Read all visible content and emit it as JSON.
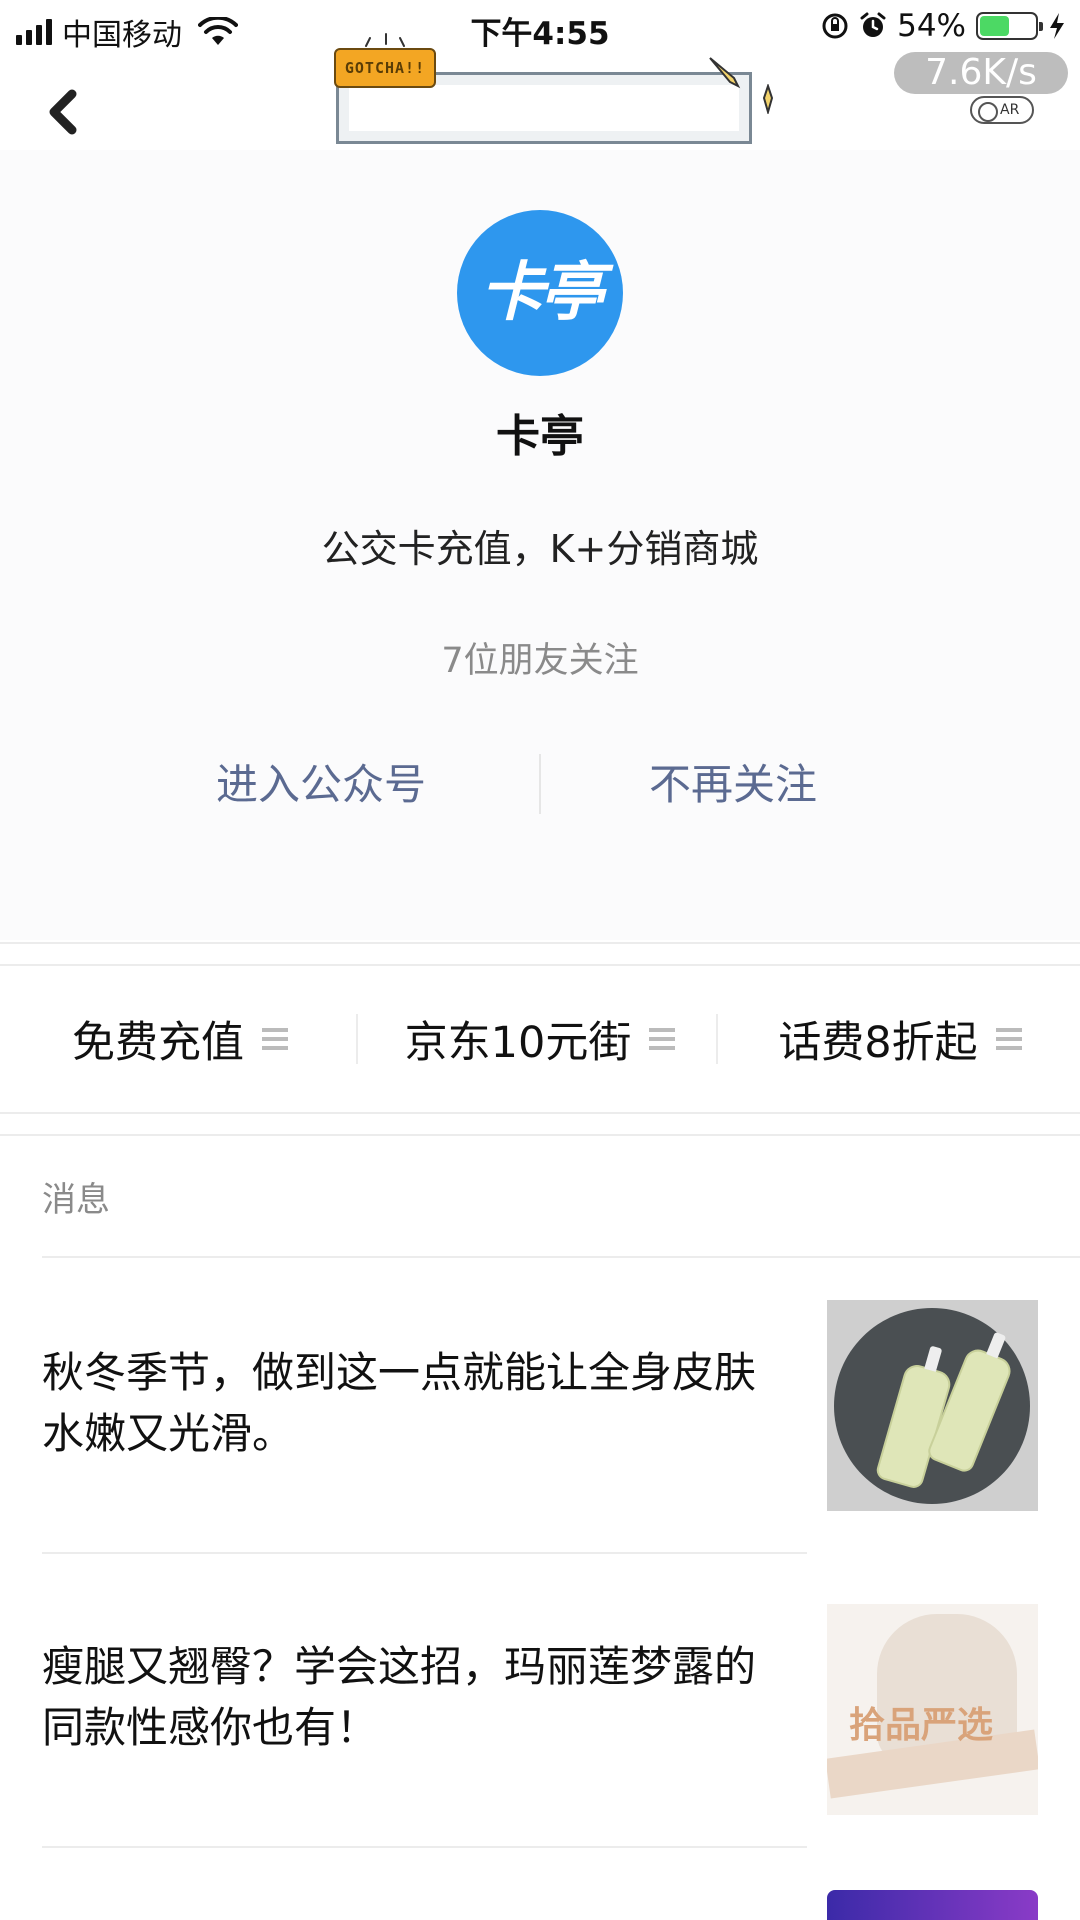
{
  "status_bar": {
    "carrier": "中国移动",
    "time": "下午4:55",
    "battery_percent": "54%",
    "battery_level": 0.54,
    "net_speed": "7.6K/s",
    "ar_label": "AR"
  },
  "nav": {
    "badge": "GOTCHA!!"
  },
  "profile": {
    "avatar_text": "卡亭",
    "avatar_color": "#2e97ee",
    "name": "卡亭",
    "description": "公交卡充值，K+分销商城",
    "friends_following": "7位朋友关注",
    "actions": {
      "enter": "进入公众号",
      "unfollow": "不再关注"
    }
  },
  "menu": {
    "items": [
      {
        "label": "免费充值"
      },
      {
        "label": "京东10元街"
      },
      {
        "label": "话费8折起"
      }
    ]
  },
  "messages": {
    "section_title": "消息",
    "items": [
      {
        "title": "秋冬季节，做到这一点就能让全身皮肤水嫩又光滑。"
      },
      {
        "title": "瘦腿又翘臀？学会这招，玛丽莲梦露的同款性感你也有！",
        "thumb_text": "拾品严选"
      }
    ]
  },
  "colors": {
    "action_text": "#5b6a91",
    "accent_blue": "#2e97ee",
    "battery_green": "#4cd964"
  }
}
